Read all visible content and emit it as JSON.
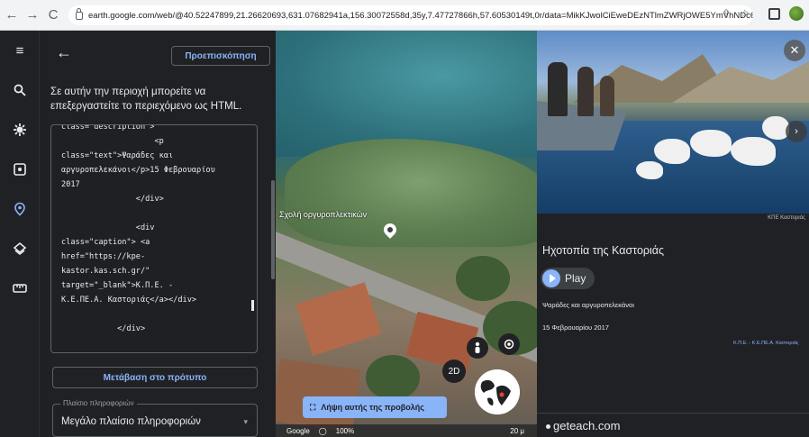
{
  "browser": {
    "url": "earth.google.com/web/@40.52247899,21.26620693,631.07682941a,156.30072558d,35y,7.47727866h,57.60530149t,0r/data=MikKJwolCiEweDEzNTlmZWRjOWE5YmVhNDc6...",
    "back_icon": "←",
    "forward_icon": "→",
    "reload_icon": "C"
  },
  "editor": {
    "back_label": "←",
    "preview_label": "Προεπισκόπηση",
    "intro_text": "Σε αυτήν την περιοχή μπορείτε να επεξεργαστείτε το περιεχόμενο ως HTML.",
    "code_lines": [
      "class=\"description\">",
      "                    <p",
      "class=\"text\">Ψαράδες και",
      "αργυροπελεκάνοι</p>15 Φεβρουαρίου",
      "2017",
      "                </div>",
      "",
      "                <div",
      "class=\"caption\"> <a",
      "href=\"https://kpe-",
      "kastor.kas.sch.gr/\"",
      "target=\"_blank\">Κ.Π.Ε. -",
      "Κ.Ε.ΠΕ.Α. Καστοριάς</a></div>",
      "",
      "            </div>"
    ],
    "template_button_label": "Μετάβαση στο πρότυπο",
    "select_legend": "Πλαίσιο πληροφοριών",
    "select_value": "Μεγάλο πλαίσιο πληροφοριών"
  },
  "map": {
    "place_label": "Σχολή οργυροπλεκτικών",
    "zoom_2d": "2D",
    "capture_label": "Λήψη αυτής της προβολής",
    "footer_brand": "Google",
    "footer_zoom": "100%",
    "footer_scale": "20 μ"
  },
  "info": {
    "photo_credit": "ΚΠΕ Καστοριάς",
    "title": "Ηχοτοπία της Καστοριάς",
    "play_label": "Play",
    "line1": "Ψαράδες και αργυροπελεκάνοι",
    "line2": "15 Φεβρουαρίου 2017",
    "link_text": "Κ.Π.Ε. - Κ.Ε.ΠΕ.Α. Καστοριάς",
    "footer_text": "geteach.com"
  }
}
